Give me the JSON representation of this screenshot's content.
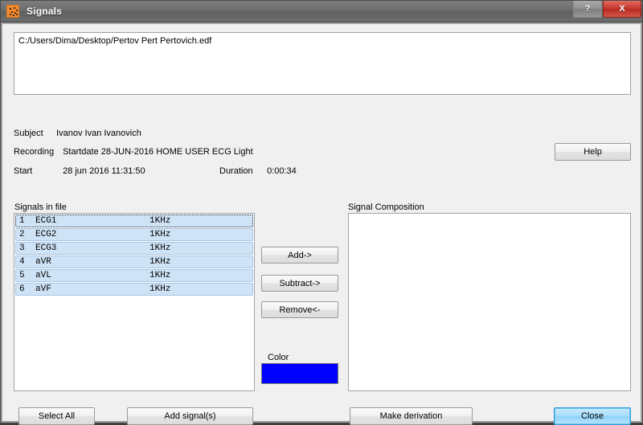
{
  "window": {
    "title": "Signals",
    "icon": "signals-app-icon",
    "buttons": {
      "help": "?",
      "close": "X"
    }
  },
  "filepath": {
    "value": "C:/Users/Dima/Desktop/Pertov Pert Pertovich.edf"
  },
  "info": {
    "subject_label": "Subject",
    "subject_value": "Ivanov Ivan Ivanovich",
    "recording_label": "Recording",
    "recording_value": "Startdate 28-JUN-2016 HOME USER ECG Light",
    "start_label": "Start",
    "start_value": "28 jun 2016   11:31:50",
    "duration_label": "Duration",
    "duration_value": "0:00:34"
  },
  "help_button": "Help",
  "signals_panel": {
    "label": "Signals in file",
    "rows": [
      {
        "index": "1",
        "name": "ECG1",
        "rate": "1KHz"
      },
      {
        "index": "2",
        "name": "ECG2",
        "rate": "1KHz"
      },
      {
        "index": "3",
        "name": "ECG3",
        "rate": "1KHz"
      },
      {
        "index": "4",
        "name": "aVR",
        "rate": "1KHz"
      },
      {
        "index": "5",
        "name": "aVL",
        "rate": "1KHz"
      },
      {
        "index": "6",
        "name": "aVF",
        "rate": "1KHz"
      }
    ]
  },
  "middle_buttons": {
    "add": "Add->",
    "subtract": "Subtract->",
    "remove": "Remove<-"
  },
  "color_section": {
    "label": "Color",
    "value": "#0000FF"
  },
  "composition_panel": {
    "label": "Signal Composition",
    "items": []
  },
  "bottom_buttons": {
    "select_all": "Select All",
    "add_signals": "Add signal(s)",
    "make_derivation": "Make derivation",
    "close": "Close"
  }
}
